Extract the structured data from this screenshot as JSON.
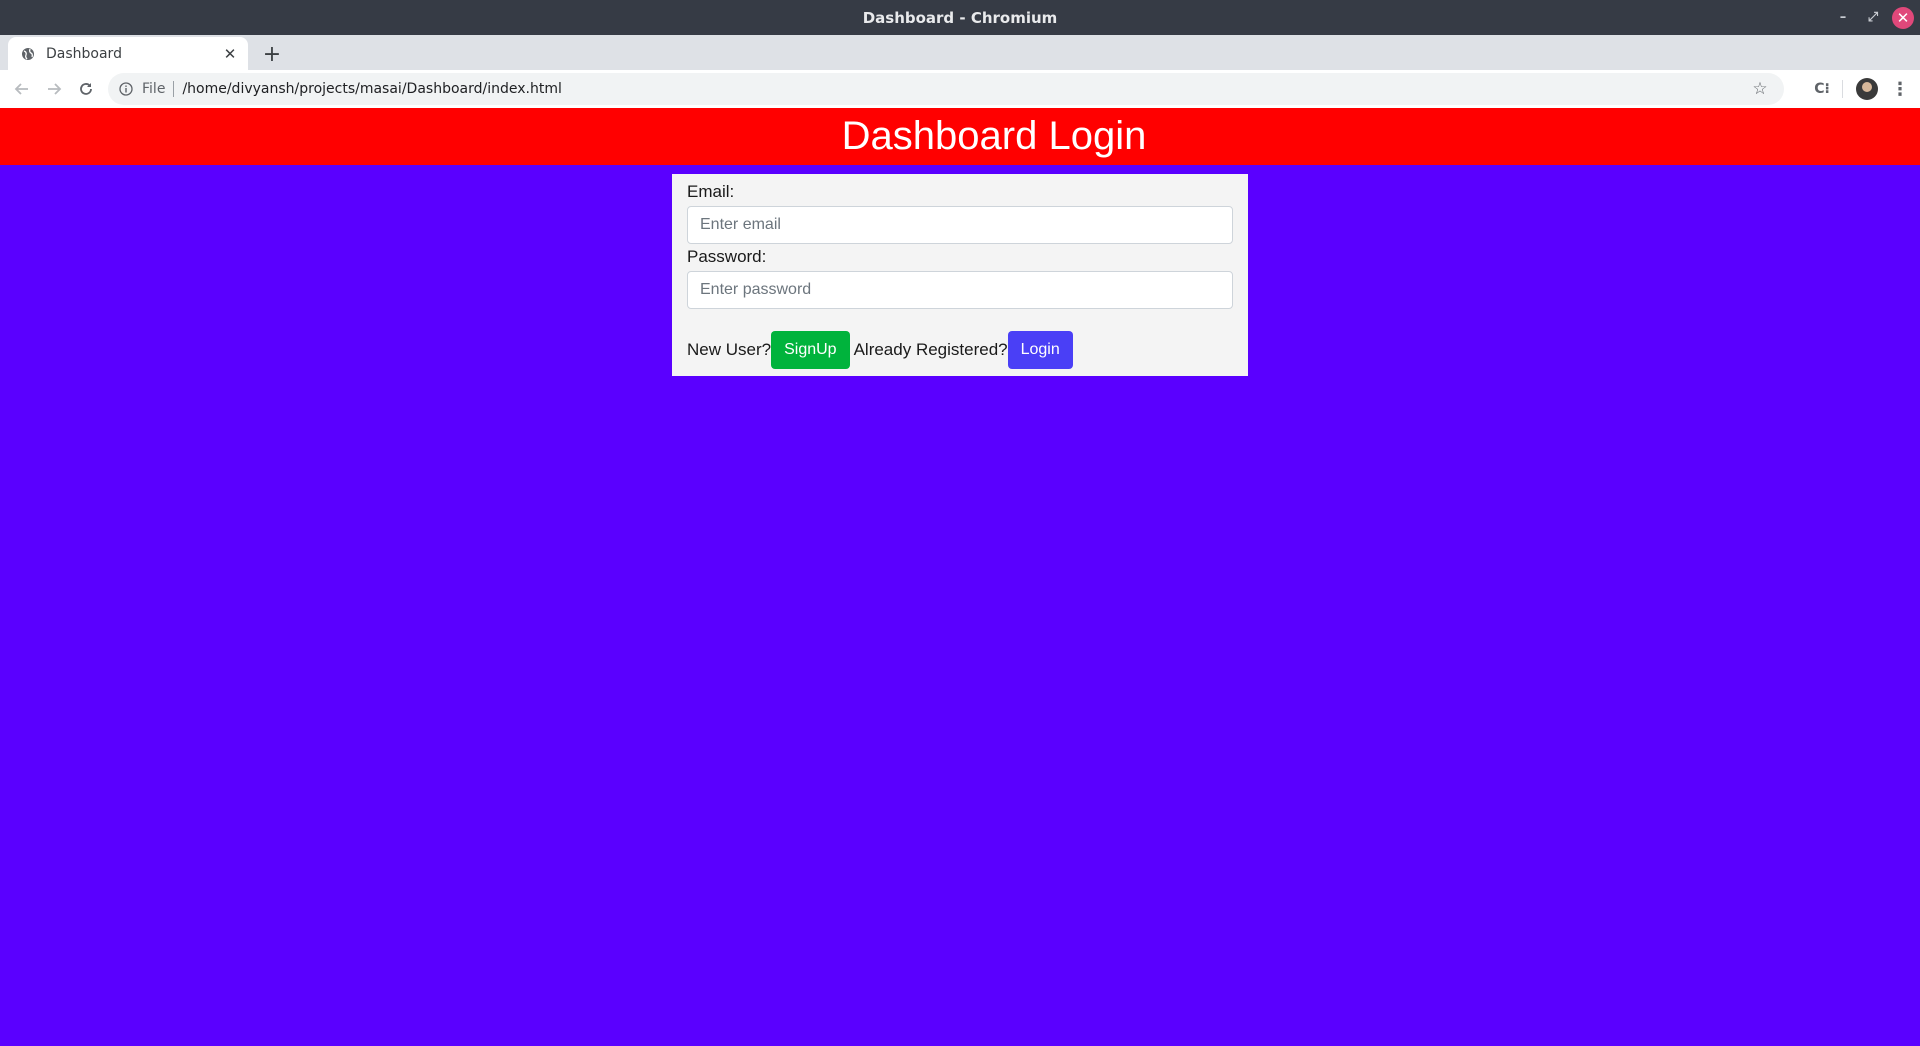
{
  "window": {
    "title": "Dashboard - Chromium",
    "controls": {
      "minimize": "–",
      "maximize": "⤢",
      "close": "✕"
    }
  },
  "tabs": [
    {
      "title": "Dashboard",
      "favicon": "globe-icon",
      "active": true
    }
  ],
  "toolbar": {
    "scheme_label": "File",
    "url": "/home/divyansh/projects/masai/Dashboard/index.html",
    "icons": [
      "back-arrow-icon",
      "forward-arrow-icon",
      "reload-icon",
      "info-icon",
      "star-icon",
      "extension-icon",
      "profile-avatar",
      "menu-icon"
    ]
  },
  "page": {
    "header_title": "Dashboard Login",
    "form": {
      "email_label": "Email:",
      "email_placeholder": "Enter email",
      "email_value": "",
      "password_label": "Password:",
      "password_placeholder": "Enter password",
      "password_value": "",
      "new_user_text": "New User?",
      "signup_label": "SignUp",
      "registered_text": "Already Registered?",
      "login_label": "Login"
    }
  },
  "colors": {
    "page_background": "#5a00ff",
    "header_background": "#ff0000",
    "card_background": "#f4f4f4",
    "signup_button": "#00b33c",
    "login_button": "#4a3ff6",
    "titlebar": "#363b45",
    "close_button": "#e0487a"
  }
}
